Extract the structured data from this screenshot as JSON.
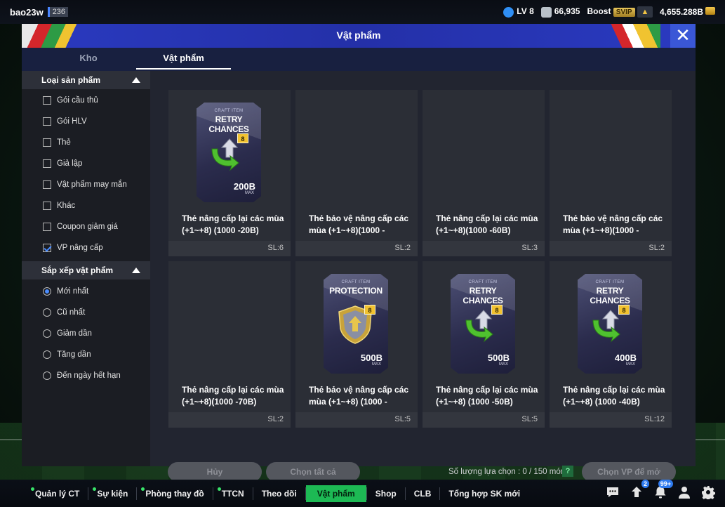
{
  "topbar": {
    "username": "bao23w",
    "user_count": "236",
    "level": "LV 8",
    "coins": "66,935",
    "boost_label": "Boost",
    "svip_label": "SVIP",
    "bp": "4,655.288B"
  },
  "window": {
    "title": "Vật phẩm",
    "tabs": [
      {
        "label": "Kho"
      },
      {
        "label": "Vật phẩm"
      }
    ]
  },
  "sidebar": {
    "category_header": "Loại sản phẩm",
    "categories": [
      {
        "label": "Gói cầu thủ",
        "checked": false
      },
      {
        "label": "Gói HLV",
        "checked": false
      },
      {
        "label": "Thẻ",
        "checked": false
      },
      {
        "label": "Giả lập",
        "checked": false
      },
      {
        "label": "Vật phẩm may mắn",
        "checked": false
      },
      {
        "label": "Khác",
        "checked": false
      },
      {
        "label": "Coupon giảm giá",
        "checked": false
      },
      {
        "label": "VP nâng cấp",
        "checked": true
      }
    ],
    "sort_header": "Sắp xếp vật phẩm",
    "sorts": [
      {
        "label": "Mới nhất",
        "selected": true
      },
      {
        "label": "Cũ nhất",
        "selected": false
      },
      {
        "label": "Giảm dần",
        "selected": false
      },
      {
        "label": "Tăng dần",
        "selected": false
      },
      {
        "label": "Đến ngày hết hạn",
        "selected": false
      }
    ]
  },
  "items": [
    {
      "name": "Thẻ nâng cấp lại các mùa (+1~+8) (1000 -20B)",
      "qty": "SL:6",
      "image": "retry",
      "pack_small": "CRAFT ITEM",
      "pack_title": "RETRY CHANCES",
      "level": "8",
      "value": "200B",
      "max": "MAX"
    },
    {
      "name": "Thẻ bảo vệ nâng cấp các mùa (+1~+8)(1000 -",
      "qty": "SL:2",
      "image": "none"
    },
    {
      "name": "Thẻ nâng cấp lại các mùa (+1~+8)(1000 -60B)",
      "qty": "SL:3",
      "image": "none"
    },
    {
      "name": "Thẻ bảo vệ nâng cấp các mùa (+1~+8)(1000 -",
      "qty": "SL:2",
      "image": "none"
    },
    {
      "name": "Thẻ nâng cấp lại các mùa (+1~+8)(1000 -70B)",
      "qty": "SL:2",
      "image": "none"
    },
    {
      "name": "Thẻ bảo vệ nâng cấp các mùa (+1~+8) (1000 -",
      "qty": "SL:5",
      "image": "protection",
      "pack_small": "CRAFT ITEM",
      "pack_title": "PROTECTION",
      "level": "8",
      "value": "500B",
      "max": "MAX"
    },
    {
      "name": "Thẻ nâng cấp lại các mùa (+1~+8) (1000 -50B)",
      "qty": "SL:5",
      "image": "retry",
      "pack_small": "CRAFT ITEM",
      "pack_title": "RETRY CHANCES",
      "level": "8",
      "value": "500B",
      "max": "MAX"
    },
    {
      "name": "Thẻ nâng cấp lại các mùa (+1~+8) (1000 -40B)",
      "qty": "SL:12",
      "image": "retry",
      "pack_small": "CRAFT ITEM",
      "pack_title": "RETRY CHANCES",
      "level": "8",
      "value": "400B",
      "max": "MAX"
    }
  ],
  "actions": {
    "cancel": "Hủy",
    "select_all": "Chọn tất cả",
    "selection_count": "Số lượng lựa chọn : 0 / 150 món",
    "help": "?",
    "open": "Chọn VP để mở"
  },
  "bottomnav": {
    "items": [
      {
        "label": "Quản lý CT",
        "dot": true
      },
      {
        "label": "Sự kiện",
        "dot": true
      },
      {
        "label": "Phòng thay đồ",
        "dot": true
      },
      {
        "label": "TTCN",
        "dot": true
      },
      {
        "label": "Theo dõi",
        "dot": false
      },
      {
        "label": "Vật phẩm",
        "dot": false,
        "active": true
      },
      {
        "label": "Shop",
        "dot": false
      },
      {
        "label": "CLB",
        "dot": false
      },
      {
        "label": "Tổng hợp SK mới",
        "dot": false
      }
    ],
    "icons": [
      {
        "name": "chat-icon",
        "badge": ""
      },
      {
        "name": "upload-icon",
        "badge": "2"
      },
      {
        "name": "bell-icon",
        "badge": "99+"
      },
      {
        "name": "profile-icon",
        "badge": ""
      },
      {
        "name": "settings-gear-icon",
        "badge": ""
      }
    ]
  },
  "colors": {
    "accent_green": "#1db954",
    "header_blue": "#2a3ac0",
    "check_blue": "#4a8cff"
  }
}
